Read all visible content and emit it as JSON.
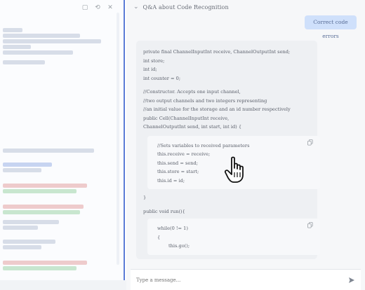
{
  "chat": {
    "title": "Q&A about Code Recognition",
    "user_message": "Correct code errors",
    "answer_lines_top": [
      "private final ChannelInputInt receive, ChannelOutputInt send;",
      "int store;",
      "int id;",
      "int counter = 0;"
    ],
    "answer_lines_ctor": [
      "//Constructor. Accepts one input channel,",
      "//two output channels and two integers representing",
      "//an initial value for the storage and an id number respectively",
      "public Cell(ChannelInputInt receive,",
      "ChannelOutputInt send, int start, int id) {"
    ],
    "code_block_1": [
      "//Sets variables to received parameters",
      "this.receive = receive;",
      "this.send = send;",
      "this.store = start;",
      "this.id = id;"
    ],
    "closing_brace": "}",
    "run_signature": "public void run(){",
    "code_block_2": [
      "while(0 != 1)",
      "{",
      "this.go();"
    ],
    "composer_placeholder": "Type a message..."
  },
  "icons": {
    "collapse": "chevron-down-icon",
    "copy": "copy-icon",
    "send": "send-icon",
    "cursor": "hand-pointer-icon"
  }
}
